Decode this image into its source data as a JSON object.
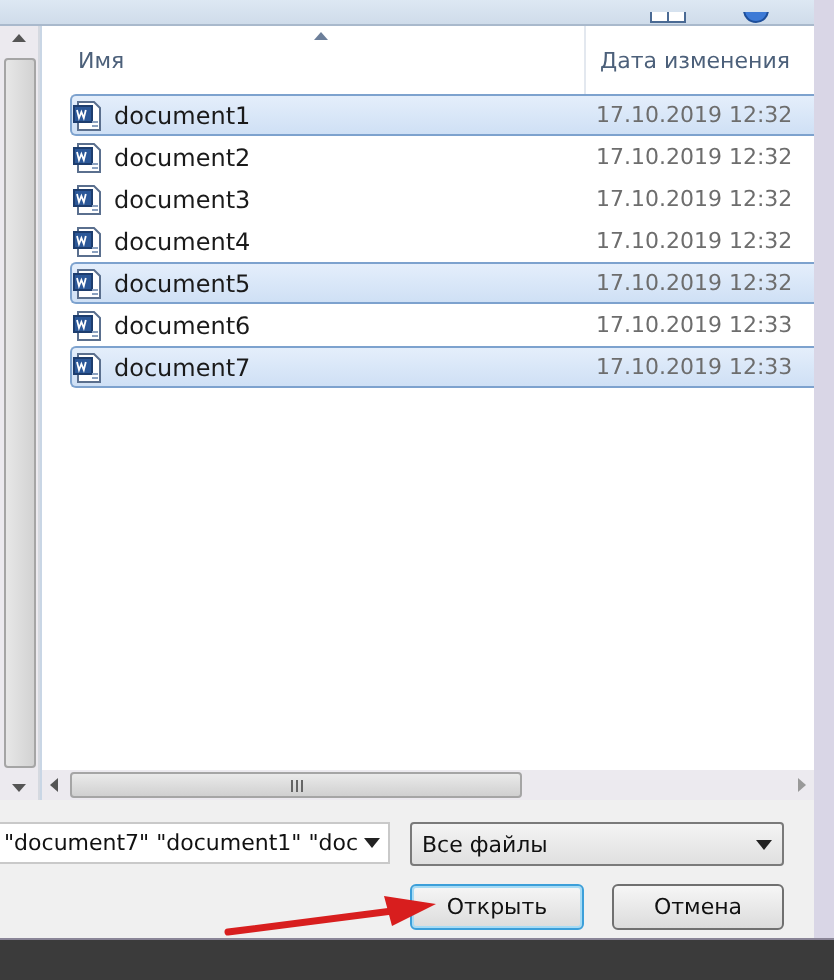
{
  "file_list": {
    "columns": [
      {
        "label": "Имя",
        "sorted": true
      },
      {
        "label": "Дата изменения",
        "sorted": false
      }
    ],
    "rows": [
      {
        "name": "document1",
        "modified": "17.10.2019 12:32",
        "selected": true
      },
      {
        "name": "document2",
        "modified": "17.10.2019 12:32",
        "selected": false
      },
      {
        "name": "document3",
        "modified": "17.10.2019 12:32",
        "selected": false
      },
      {
        "name": "document4",
        "modified": "17.10.2019 12:32",
        "selected": false
      },
      {
        "name": "document5",
        "modified": "17.10.2019 12:32",
        "selected": true
      },
      {
        "name": "document6",
        "modified": "17.10.2019 12:33",
        "selected": false
      },
      {
        "name": "document7",
        "modified": "17.10.2019 12:33",
        "selected": true
      }
    ]
  },
  "file_name_field": {
    "value": "\"document7\" \"document1\" \"doc"
  },
  "file_type_dropdown": {
    "value": "Все файлы"
  },
  "buttons": [
    {
      "label": "Открыть",
      "kind": "primary"
    },
    {
      "label": "Отмена",
      "kind": "normal"
    }
  ]
}
